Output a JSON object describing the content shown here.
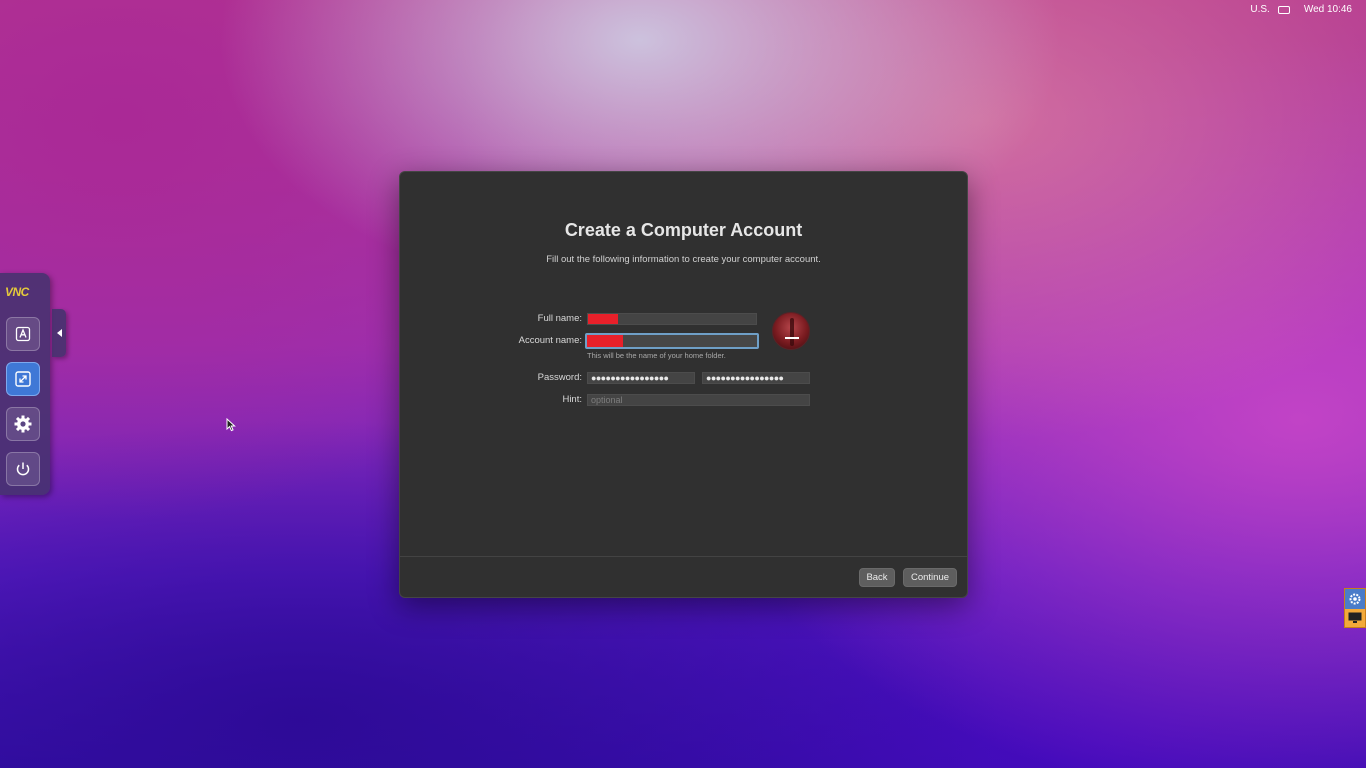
{
  "menubar": {
    "input_source": "U.S.",
    "input_icon": "keyboard-icon",
    "clock": "Wed 10:46"
  },
  "vnc_panel": {
    "logo": "VNC",
    "buttons": [
      {
        "icon": "keyboard-a-icon",
        "active": false
      },
      {
        "icon": "scale-icon",
        "active": true
      },
      {
        "icon": "gear-icon",
        "active": false
      },
      {
        "icon": "power-icon",
        "active": false
      }
    ],
    "collapse_icon": "chevron-left-icon"
  },
  "dialog": {
    "title": "Create a Computer Account",
    "subtitle": "Fill out the following information to create your computer account.",
    "full_name_label": "Full name:",
    "account_name_label": "Account name:",
    "account_name_helper": "This will be the name of your home folder.",
    "password_label": "Password:",
    "password_value": "●●●●●●●●●●●●●●●●",
    "verify_value": "●●●●●●●●●●●●●●●●",
    "hint_label": "Hint:",
    "hint_placeholder": "optional",
    "avatar_icon": "user-picture-icon",
    "back_label": "Back",
    "continue_label": "Continue",
    "redaction_color": "#e8202a"
  },
  "edge": {
    "top_icon": "gear-icon",
    "bottom_icon": "monitor-icon"
  }
}
